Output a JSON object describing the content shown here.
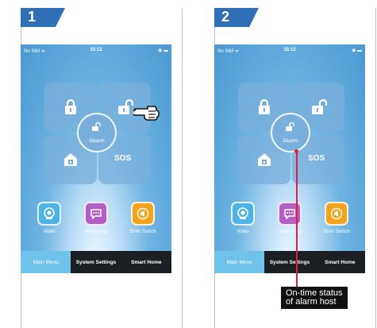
{
  "panels": [
    {
      "number": "1",
      "status": {
        "carrier": "No SIM ᯤ",
        "time": "15:12",
        "battery": "◉ ▬"
      },
      "tiles": {
        "arm": "lock-icon",
        "disarm_tile": "unlock-icon",
        "home": "home-arm-icon",
        "sos": "SOS"
      },
      "center_label": "Disarm",
      "apps": [
        {
          "label": "Video",
          "color": "#4fb3e8"
        },
        {
          "label": "Alarm Log",
          "color": "#b25fc3"
        },
        {
          "label": "Siren Switch",
          "color": "#f2a51c"
        }
      ],
      "tabs": [
        "Main Menu",
        "System Settings",
        "Smart Home"
      ]
    },
    {
      "number": "2",
      "status": {
        "carrier": "No SIM ᯤ",
        "time": "15:12",
        "battery": "◉ ▬"
      },
      "tiles": {
        "arm": "lock-icon",
        "disarm_tile": "unlock-icon",
        "home": "home-arm-icon",
        "sos": "SOS"
      },
      "center_label": "Disarm",
      "apps": [
        {
          "label": "Video",
          "color": "#4fb3e8"
        },
        {
          "label": "Alarm Log",
          "color": "#b25fc3"
        },
        {
          "label": "Siren Switch",
          "color": "#f2a51c"
        }
      ],
      "tabs": [
        "Main Menu",
        "System Settings",
        "Smart Home"
      ]
    }
  ],
  "callout": {
    "line1": "On-time status",
    "line2": "of alarm host",
    "color": "#e01f3d"
  },
  "badge_color": "#2e6fb5"
}
